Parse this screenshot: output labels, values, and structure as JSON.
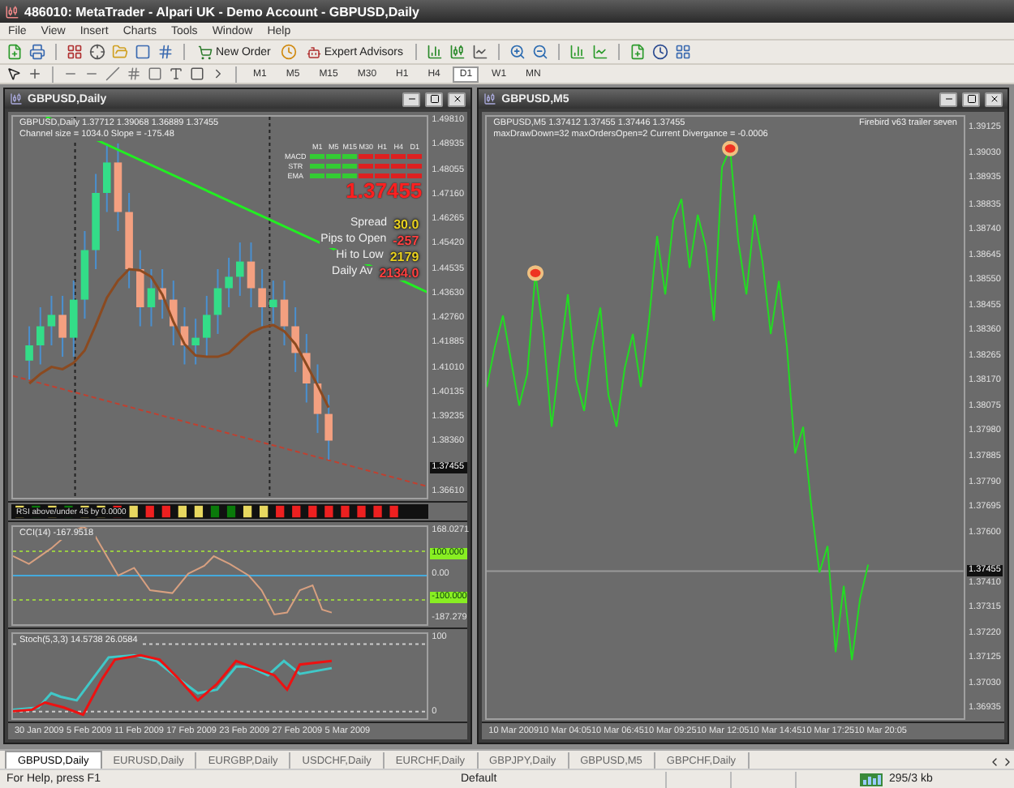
{
  "window": {
    "title": "486010: MetaTrader - Alpari UK - Demo Account - GBPUSD,Daily"
  },
  "menu": [
    "File",
    "View",
    "Insert",
    "Charts",
    "Tools",
    "Window",
    "Help"
  ],
  "toolbar": {
    "buttons": [
      "New Order",
      "Expert Advisors"
    ],
    "timeframes": [
      {
        "label": "M1",
        "selected": false
      },
      {
        "label": "M5",
        "selected": false
      },
      {
        "label": "M15",
        "selected": false
      },
      {
        "label": "M30",
        "selected": false
      },
      {
        "label": "H1",
        "selected": false
      },
      {
        "label": "H4",
        "selected": false
      },
      {
        "label": "D1",
        "selected": true
      },
      {
        "label": "W1",
        "selected": false
      },
      {
        "label": "MN",
        "selected": false
      }
    ]
  },
  "daily_chart": {
    "title": "GBPUSD,Daily",
    "header": [
      "GBPUSD,Daily  1.37712 1.39068 1.36889 1.37455",
      "Channel size = 1034.0 Slope = -175.48"
    ],
    "signal_panel": {
      "rows": [
        "MACD",
        "STR",
        "EMA"
      ],
      "timeframes": [
        {
          "label": "M1",
          "color": "#33cc33"
        },
        {
          "label": "M5",
          "color": "#33cc33"
        },
        {
          "label": "M15",
          "color": "#33cc33"
        },
        {
          "label": "M30",
          "color": "#dd2020"
        },
        {
          "label": "H1",
          "color": "#dd2020"
        },
        {
          "label": "H4",
          "color": "#dd2020"
        },
        {
          "label": "D1",
          "color": "#dd2020"
        }
      ],
      "price": "1.37455",
      "stats": [
        {
          "label": "Spread",
          "value": "30.0",
          "color": "#e8d020"
        },
        {
          "label": "Pips to Open",
          "value": "-257",
          "color": "#ff4040"
        },
        {
          "label": "Hi to Low",
          "value": "2179",
          "color": "#e8d020"
        },
        {
          "label": "Daily Av",
          "value": "2134.0",
          "color": "#ff4040"
        }
      ]
    },
    "price_axis": [
      {
        "label": "1.49810",
        "current": false
      },
      {
        "label": "1.48935",
        "current": false
      },
      {
        "label": "1.48055",
        "current": false
      },
      {
        "label": "1.47160",
        "current": false
      },
      {
        "label": "1.46265",
        "current": false
      },
      {
        "label": "1.45420",
        "current": false
      },
      {
        "label": "1.44535",
        "current": false
      },
      {
        "label": "1.43630",
        "current": false
      },
      {
        "label": "1.42760",
        "current": false
      },
      {
        "label": "1.41885",
        "current": false
      },
      {
        "label": "1.41010",
        "current": false
      },
      {
        "label": "1.40135",
        "current": false
      },
      {
        "label": "1.39235",
        "current": false
      },
      {
        "label": "1.38360",
        "current": false
      },
      {
        "label": "1.37455",
        "current": true
      },
      {
        "label": "1.36610",
        "current": false
      }
    ],
    "strip_label": "RSI above/under 45 by 0.0000",
    "cci": {
      "label": "CCI(14) -167.9518",
      "axis": [
        {
          "label": "168.0271",
          "highlight": false
        },
        {
          "label": "100.000",
          "highlight": true
        },
        {
          "label": "0.00",
          "highlight": false
        },
        {
          "label": "-100.000",
          "highlight": true
        },
        {
          "label": "-187.279",
          "highlight": false
        }
      ]
    },
    "stoch": {
      "label": "Stoch(5,3,3) 14.5738 26.0584",
      "axis": [
        "100",
        "0"
      ]
    },
    "dates": [
      "30 Jan 2009",
      "5 Feb 2009",
      "11 Feb 2009",
      "17 Feb 2009",
      "23 Feb 2009",
      "27 Feb 2009",
      "5 Mar 2009"
    ]
  },
  "m5_chart": {
    "title": "GBPUSD,M5",
    "header": [
      "GBPUSD,M5  1.37412 1.37455 1.37446 1.37455",
      "maxDrawDown=32  maxOrdersOpen=2 Current Divergance = -0.0006"
    ],
    "expert": "Firebird v63 trailer seven",
    "chart_data": {
      "type": "line",
      "ylim": [
        1.369,
        1.3917
      ],
      "yticks": [
        {
          "value": 1.39125,
          "label": "1.39125"
        },
        {
          "value": 1.3903,
          "label": "1.39030"
        },
        {
          "value": 1.38935,
          "label": "1.38935"
        },
        {
          "value": 1.38835,
          "label": "1.38835"
        },
        {
          "value": 1.3874,
          "label": "1.38740"
        },
        {
          "value": 1.38645,
          "label": "1.38645"
        },
        {
          "value": 1.3855,
          "label": "1.38550"
        },
        {
          "value": 1.38455,
          "label": "1.38455"
        },
        {
          "value": 1.3836,
          "label": "1.38360"
        },
        {
          "value": 1.38265,
          "label": "1.38265"
        },
        {
          "value": 1.3817,
          "label": "1.38170"
        },
        {
          "value": 1.38075,
          "label": "1.38075"
        },
        {
          "value": 1.3798,
          "label": "1.37980"
        },
        {
          "value": 1.37885,
          "label": "1.37885"
        },
        {
          "value": 1.3779,
          "label": "1.37790"
        },
        {
          "value": 1.37695,
          "label": "1.37695"
        },
        {
          "value": 1.376,
          "label": "1.37600"
        },
        {
          "value": 1.3741,
          "label": "1.37410"
        },
        {
          "value": 1.37315,
          "label": "1.37315"
        },
        {
          "value": 1.3722,
          "label": "1.37220"
        },
        {
          "value": 1.37125,
          "label": "1.37125"
        },
        {
          "value": 1.3703,
          "label": "1.37030"
        },
        {
          "value": 1.36935,
          "label": "1.36935"
        }
      ],
      "ref_lines": [
        {
          "axis": "y",
          "value": 1.37455,
          "label": "1.37455"
        }
      ],
      "series": [
        {
          "color": "#22dd22",
          "values": [
            1.3815,
            1.383,
            1.3842,
            1.3825,
            1.3808,
            1.382,
            1.3858,
            1.3835,
            1.38,
            1.3826,
            1.385,
            1.3818,
            1.3806,
            1.383,
            1.3845,
            1.3812,
            1.38,
            1.3822,
            1.3835,
            1.3815,
            1.384,
            1.3872,
            1.385,
            1.3878,
            1.3886,
            1.386,
            1.388,
            1.3868,
            1.384,
            1.3898,
            1.3905,
            1.387,
            1.385,
            1.388,
            1.3862,
            1.3835,
            1.3855,
            1.383,
            1.379,
            1.38,
            1.377,
            1.3745,
            1.3755,
            1.3715,
            1.374,
            1.3712,
            1.3735,
            1.3748
          ]
        }
      ]
    },
    "dates": [
      "10 Mar 2009",
      "10 Mar 04:05",
      "10 Mar 06:45",
      "10 Mar 09:25",
      "10 Mar 12:05",
      "10 Mar 14:45",
      "10 Mar 17:25",
      "10 Mar 20:05"
    ]
  },
  "tabs": [
    {
      "label": "GBPUSD,Daily",
      "selected": true
    },
    {
      "label": "EURUSD,Daily",
      "selected": false
    },
    {
      "label": "EURGBP,Daily",
      "selected": false
    },
    {
      "label": "USDCHF,Daily",
      "selected": false
    },
    {
      "label": "EURCHF,Daily",
      "selected": false
    },
    {
      "label": "GBPJPY,Daily",
      "selected": false
    },
    {
      "label": "GBPUSD,M5",
      "selected": false
    },
    {
      "label": "GBPCHF,Daily",
      "selected": false
    }
  ],
  "status_bar": {
    "help": "For Help, press F1",
    "profile": "Default",
    "traffic": "295/3 kb"
  }
}
